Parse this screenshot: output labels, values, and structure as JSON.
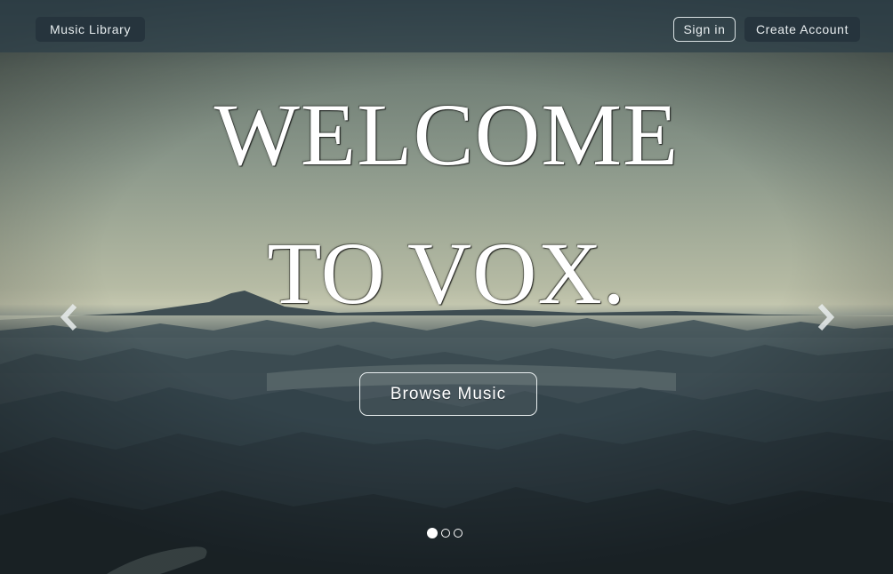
{
  "navbar": {
    "brand_label": "Music Library",
    "signin_label": "Sign in",
    "create_account_label": "Create Account"
  },
  "hero": {
    "headline_line1": "WELCOME",
    "headline_line2": "TO VOX.",
    "browse_label": "Browse Music",
    "prev_icon": "chevron-left-icon",
    "next_icon": "chevron-right-icon"
  },
  "carousel": {
    "slide_count": 3,
    "active_index": 0
  },
  "colors": {
    "navbar_bg": "#2c3e48",
    "button_dark": "#26343d",
    "text_white": "#ffffff"
  }
}
